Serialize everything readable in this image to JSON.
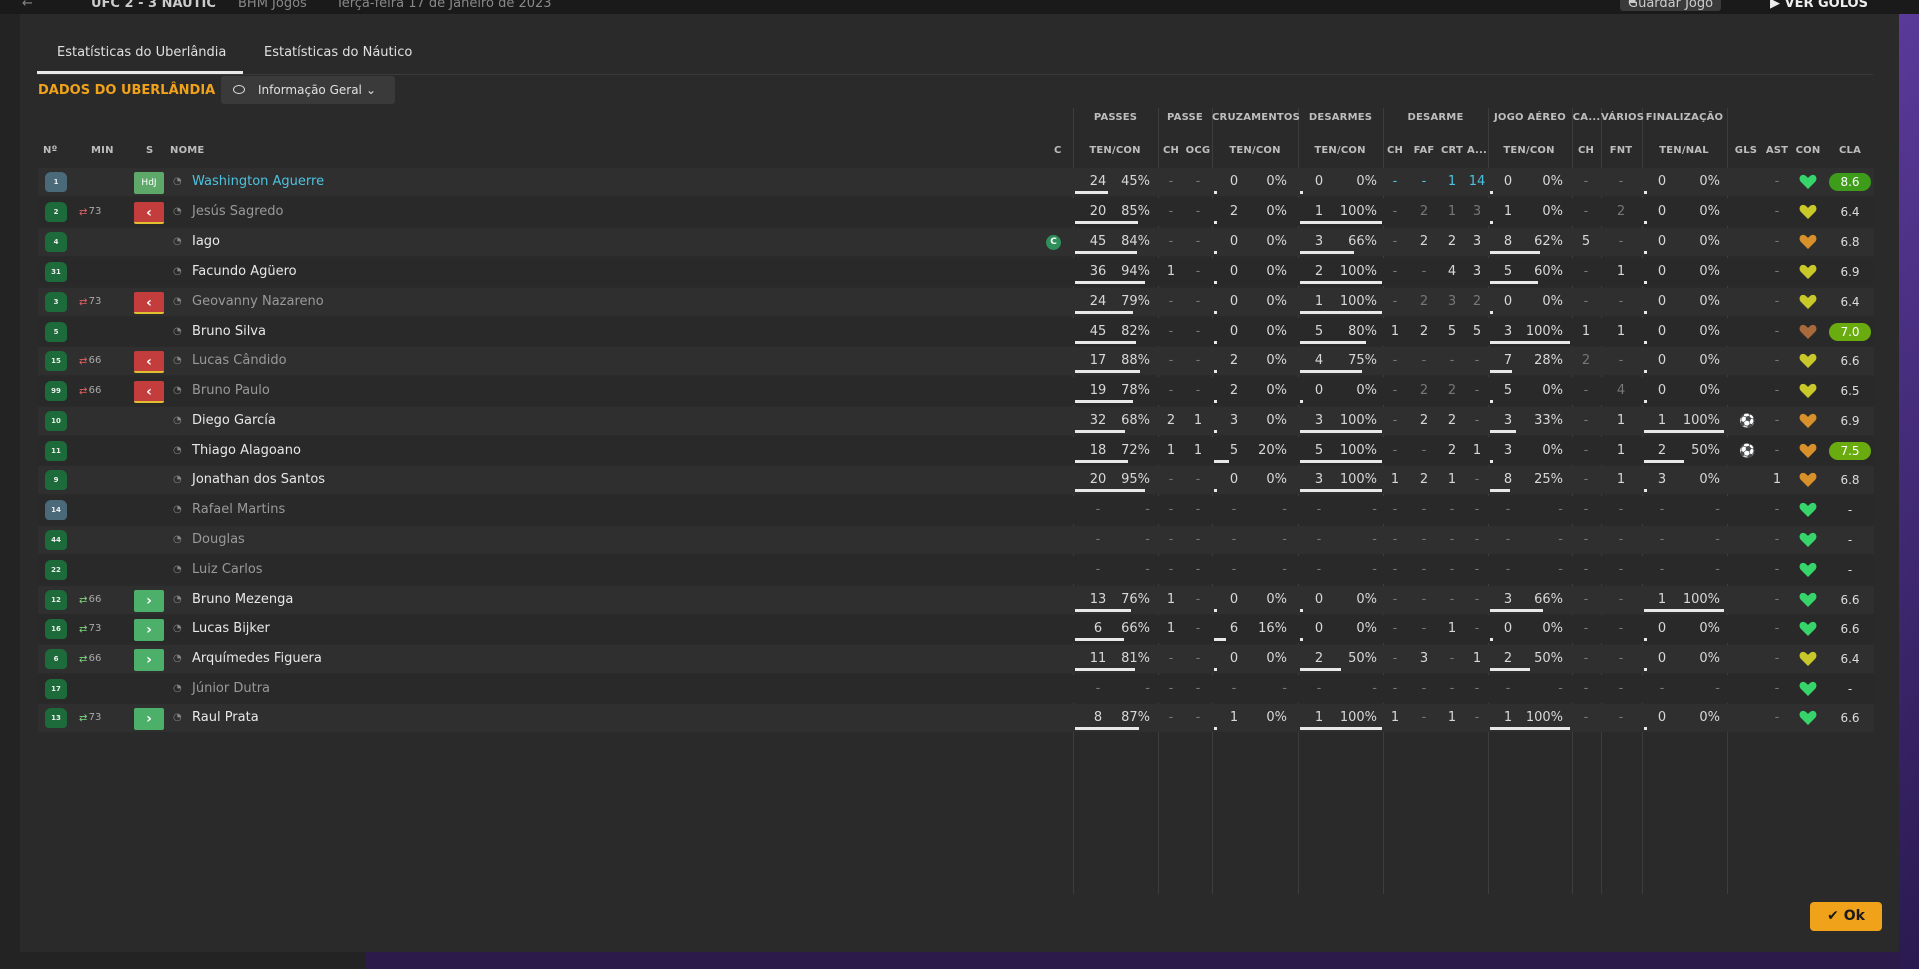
{
  "topbar": {
    "score": "UFC  2 - 3  NÁUTIC",
    "competition": "BHM Jogos",
    "date": "Terça-feira 17 de Janeiro de 2023",
    "save_label": "Guardar Jogo",
    "goals_label": "VER GOLOS"
  },
  "tabs": [
    "Estatísticas do Uberlândia",
    "Estatísticas do Náutico"
  ],
  "section_title": "DADOS DO UBERLÂNDIA",
  "view_dropdown": "Informação Geral",
  "group_headers": {
    "passes": "PASSES",
    "passe": "PASSE",
    "cruzamentos": "CRUZAMENTOS",
    "desarmes": "DESARMES",
    "desarme": "DESARME",
    "jogo_aereo": "JOGO AÉREO",
    "ca": "CA...",
    "varios": "VÁRIOS",
    "finalizacao": "FINALIZAÇÃO"
  },
  "col_headers": {
    "num": "Nº",
    "min": "MIN",
    "s": "S",
    "nome": "NOME",
    "c": "C",
    "passes": "TEN/CON",
    "pch": "CH",
    "pocg": "OCG",
    "cruz": "TEN/CON",
    "des": "TEN/CON",
    "dch": "CH",
    "dfaf": "FAF",
    "dcrt": "CRT",
    "da": "A...",
    "ja": "TEN/CON",
    "cach": "CH",
    "vfnt": "FNT",
    "fin": "TEN/NAL",
    "gls": "GLS",
    "ast": "AST",
    "con": "CON",
    "cla": "CLA"
  },
  "players": [
    {
      "num": "1",
      "gk": true,
      "min": "",
      "sub": "hdj",
      "sub_label": "HdJ",
      "name": "Washington Aguerre",
      "style": "link",
      "cap": false,
      "p": [
        "24",
        "45%"
      ],
      "pch": "-",
      "pocg": "-",
      "cz": [
        "0",
        "0%"
      ],
      "ds": [
        "0",
        "0%"
      ],
      "dch": "-",
      "dfaf": "-",
      "dcrt": "1",
      "da": "14",
      "ja": [
        "0",
        "0%"
      ],
      "cach": "-",
      "fnt": "-",
      "fn": [
        "0",
        "0%"
      ],
      "gls": "",
      "ast": "-",
      "rating": "8.6",
      "rstyle": "green",
      "heart": "green",
      "special": "gk"
    },
    {
      "num": "2",
      "min": "73",
      "sub": "out",
      "name": "Jesús Sagredo",
      "style": "dim",
      "p": [
        "20",
        "85%"
      ],
      "pch": "-",
      "pocg": "-",
      "cz": [
        "2",
        "0%"
      ],
      "ds": [
        "1",
        "100%"
      ],
      "dch": "-",
      "dfaf": "2",
      "dcrt": "1",
      "da": "3",
      "ja": [
        "1",
        "0%"
      ],
      "cach": "-",
      "fnt": "2",
      "fn": [
        "0",
        "0%"
      ],
      "gls": "",
      "ast": "-",
      "rating": "6.4",
      "heart": "yellow"
    },
    {
      "num": "4",
      "min": "",
      "sub": "",
      "name": "Iago",
      "style": "",
      "cap": true,
      "cap_label": "C",
      "p": [
        "45",
        "84%"
      ],
      "pch": "-",
      "pocg": "-",
      "cz": [
        "0",
        "0%"
      ],
      "ds": [
        "3",
        "66%"
      ],
      "dch": "-",
      "dfaf": "2",
      "dcrt": "2",
      "da": "3",
      "ja": [
        "8",
        "62%"
      ],
      "cach": "5",
      "fnt": "-",
      "fn": [
        "0",
        "0%"
      ],
      "gls": "",
      "ast": "-",
      "rating": "6.8",
      "heart": "orange"
    },
    {
      "num": "31",
      "min": "",
      "sub": "",
      "name": "Facundo Agüero",
      "style": "",
      "p": [
        "36",
        "94%"
      ],
      "pch": "1",
      "pocg": "-",
      "cz": [
        "0",
        "0%"
      ],
      "ds": [
        "2",
        "100%"
      ],
      "dch": "-",
      "dfaf": "-",
      "dcrt": "4",
      "da": "3",
      "ja": [
        "5",
        "60%"
      ],
      "cach": "-",
      "fnt": "1",
      "fn": [
        "0",
        "0%"
      ],
      "gls": "",
      "ast": "-",
      "rating": "6.9",
      "heart": "yellow"
    },
    {
      "num": "3",
      "min": "73",
      "sub": "out",
      "name": "Geovanny Nazareno",
      "style": "dim",
      "p": [
        "24",
        "79%"
      ],
      "pch": "-",
      "pocg": "-",
      "cz": [
        "0",
        "0%"
      ],
      "ds": [
        "1",
        "100%"
      ],
      "dch": "-",
      "dfaf": "2",
      "dcrt": "3",
      "da": "2",
      "ja": [
        "0",
        "0%"
      ],
      "cach": "-",
      "fnt": "-",
      "fn": [
        "0",
        "0%"
      ],
      "gls": "",
      "ast": "-",
      "rating": "6.4",
      "heart": "yellow"
    },
    {
      "num": "5",
      "min": "",
      "sub": "",
      "name": "Bruno Silva",
      "style": "",
      "p": [
        "45",
        "82%"
      ],
      "pch": "-",
      "pocg": "-",
      "cz": [
        "0",
        "0%"
      ],
      "ds": [
        "5",
        "80%"
      ],
      "dch": "1",
      "dfaf": "2",
      "dcrt": "5",
      "da": "5",
      "ja": [
        "3",
        "100%"
      ],
      "cach": "1",
      "fnt": "1",
      "fn": [
        "0",
        "0%"
      ],
      "gls": "",
      "ast": "-",
      "rating": "7.0",
      "rstyle": "lime",
      "heart": "brown"
    },
    {
      "num": "15",
      "min": "66",
      "sub": "out",
      "name": "Lucas Cândido",
      "style": "dim",
      "p": [
        "17",
        "88%"
      ],
      "pch": "-",
      "pocg": "-",
      "cz": [
        "2",
        "0%"
      ],
      "ds": [
        "4",
        "75%"
      ],
      "dch": "-",
      "dfaf": "-",
      "dcrt": "-",
      "da": "-",
      "ja": [
        "7",
        "28%"
      ],
      "cach": "2",
      "fnt": "-",
      "fn": [
        "0",
        "0%"
      ],
      "gls": "",
      "ast": "-",
      "rating": "6.6",
      "heart": "yellow"
    },
    {
      "num": "99",
      "min": "66",
      "sub": "out",
      "name": "Bruno Paulo",
      "style": "dim",
      "p": [
        "19",
        "78%"
      ],
      "pch": "-",
      "pocg": "-",
      "cz": [
        "2",
        "0%"
      ],
      "ds": [
        "0",
        "0%"
      ],
      "dch": "-",
      "dfaf": "2",
      "dcrt": "2",
      "da": "-",
      "ja": [
        "5",
        "0%"
      ],
      "cach": "-",
      "fnt": "4",
      "fn": [
        "0",
        "0%"
      ],
      "gls": "",
      "ast": "-",
      "rating": "6.5",
      "heart": "yellow"
    },
    {
      "num": "10",
      "min": "",
      "sub": "",
      "name": "Diego García",
      "style": "",
      "p": [
        "32",
        "68%"
      ],
      "pch": "2",
      "pocg": "1",
      "cz": [
        "3",
        "0%"
      ],
      "ds": [
        "3",
        "100%"
      ],
      "dch": "-",
      "dfaf": "2",
      "dcrt": "2",
      "da": "-",
      "ja": [
        "3",
        "33%"
      ],
      "cach": "-",
      "fnt": "1",
      "fn": [
        "1",
        "100%"
      ],
      "gls": "ball",
      "ast": "-",
      "rating": "6.9",
      "heart": "orange"
    },
    {
      "num": "11",
      "min": "",
      "sub": "",
      "name": "Thiago Alagoano",
      "style": "",
      "p": [
        "18",
        "72%"
      ],
      "pch": "1",
      "pocg": "1",
      "cz": [
        "5",
        "20%"
      ],
      "ds": [
        "5",
        "100%"
      ],
      "dch": "-",
      "dfaf": "-",
      "dcrt": "2",
      "da": "1",
      "ja": [
        "3",
        "0%"
      ],
      "cach": "-",
      "fnt": "1",
      "fn": [
        "2",
        "50%"
      ],
      "gls": "ball",
      "ast": "-",
      "rating": "7.5",
      "rstyle": "lime",
      "heart": "orange"
    },
    {
      "num": "9",
      "min": "",
      "sub": "",
      "name": "Jonathan dos Santos",
      "style": "",
      "p": [
        "20",
        "95%"
      ],
      "pch": "-",
      "pocg": "-",
      "cz": [
        "0",
        "0%"
      ],
      "ds": [
        "3",
        "100%"
      ],
      "dch": "1",
      "dfaf": "2",
      "dcrt": "1",
      "da": "-",
      "ja": [
        "8",
        "25%"
      ],
      "cach": "-",
      "fnt": "1",
      "fn": [
        "3",
        "0%"
      ],
      "gls": "",
      "ast": "1",
      "rating": "6.8",
      "heart": "orange"
    },
    {
      "num": "14",
      "gk": true,
      "min": "",
      "sub": "",
      "name": "Rafael Martins",
      "style": "dim",
      "p": [
        "-",
        "-"
      ],
      "pch": "-",
      "pocg": "-",
      "cz": [
        "-",
        "-"
      ],
      "ds": [
        "-",
        "-"
      ],
      "dch": "-",
      "dfaf": "-",
      "dcrt": "-",
      "da": "-",
      "ja": [
        "-",
        "-"
      ],
      "cach": "-",
      "fnt": "-",
      "fn": [
        "-",
        "-"
      ],
      "gls": "",
      "ast": "-",
      "rating": "-",
      "heart": "green"
    },
    {
      "num": "44",
      "min": "",
      "sub": "",
      "name": "Douglas",
      "style": "dim",
      "p": [
        "-",
        "-"
      ],
      "pch": "-",
      "pocg": "-",
      "cz": [
        "-",
        "-"
      ],
      "ds": [
        "-",
        "-"
      ],
      "dch": "-",
      "dfaf": "-",
      "dcrt": "-",
      "da": "-",
      "ja": [
        "-",
        "-"
      ],
      "cach": "-",
      "fnt": "-",
      "fn": [
        "-",
        "-"
      ],
      "gls": "",
      "ast": "-",
      "rating": "-",
      "heart": "green"
    },
    {
      "num": "22",
      "min": "",
      "sub": "",
      "name": "Luiz Carlos",
      "style": "dim",
      "p": [
        "-",
        "-"
      ],
      "pch": "-",
      "pocg": "-",
      "cz": [
        "-",
        "-"
      ],
      "ds": [
        "-",
        "-"
      ],
      "dch": "-",
      "dfaf": "-",
      "dcrt": "-",
      "da": "-",
      "ja": [
        "-",
        "-"
      ],
      "cach": "-",
      "fnt": "-",
      "fn": [
        "-",
        "-"
      ],
      "gls": "",
      "ast": "-",
      "rating": "-",
      "heart": "green"
    },
    {
      "num": "12",
      "min": "66",
      "sub": "in",
      "name": "Bruno Mezenga",
      "style": "",
      "p": [
        "13",
        "76%"
      ],
      "pch": "1",
      "pocg": "-",
      "cz": [
        "0",
        "0%"
      ],
      "ds": [
        "0",
        "0%"
      ],
      "dch": "-",
      "dfaf": "-",
      "dcrt": "-",
      "da": "-",
      "ja": [
        "3",
        "66%"
      ],
      "cach": "-",
      "fnt": "-",
      "fn": [
        "1",
        "100%"
      ],
      "gls": "",
      "ast": "-",
      "rating": "6.6",
      "heart": "green"
    },
    {
      "num": "16",
      "min": "73",
      "sub": "in",
      "name": "Lucas Bijker",
      "style": "",
      "p": [
        "6",
        "66%"
      ],
      "pch": "1",
      "pocg": "-",
      "cz": [
        "6",
        "16%"
      ],
      "ds": [
        "0",
        "0%"
      ],
      "dch": "-",
      "dfaf": "-",
      "dcrt": "1",
      "da": "-",
      "ja": [
        "0",
        "0%"
      ],
      "cach": "-",
      "fnt": "-",
      "fn": [
        "0",
        "0%"
      ],
      "gls": "",
      "ast": "-",
      "rating": "6.6",
      "heart": "green"
    },
    {
      "num": "6",
      "min": "66",
      "sub": "in",
      "name": "Arquímedes Figuera",
      "style": "",
      "p": [
        "11",
        "81%"
      ],
      "pch": "-",
      "pocg": "-",
      "cz": [
        "0",
        "0%"
      ],
      "ds": [
        "2",
        "50%"
      ],
      "dch": "-",
      "dfaf": "3",
      "dcrt": "-",
      "da": "1",
      "ja": [
        "2",
        "50%"
      ],
      "cach": "-",
      "fnt": "-",
      "fn": [
        "0",
        "0%"
      ],
      "gls": "",
      "ast": "-",
      "rating": "6.4",
      "heart": "yellow"
    },
    {
      "num": "17",
      "min": "",
      "sub": "",
      "name": "Júnior Dutra",
      "style": "dim",
      "p": [
        "-",
        "-"
      ],
      "pch": "-",
      "pocg": "-",
      "cz": [
        "-",
        "-"
      ],
      "ds": [
        "-",
        "-"
      ],
      "dch": "-",
      "dfaf": "-",
      "dcrt": "-",
      "da": "-",
      "ja": [
        "-",
        "-"
      ],
      "cach": "-",
      "fnt": "-",
      "fn": [
        "-",
        "-"
      ],
      "gls": "",
      "ast": "-",
      "rating": "-",
      "heart": "green"
    },
    {
      "num": "13",
      "min": "73",
      "sub": "in",
      "name": "Raul Prata",
      "style": "",
      "p": [
        "8",
        "87%"
      ],
      "pch": "-",
      "pocg": "-",
      "cz": [
        "1",
        "0%"
      ],
      "ds": [
        "1",
        "100%"
      ],
      "dch": "1",
      "dfaf": "-",
      "dcrt": "1",
      "da": "-",
      "ja": [
        "1",
        "100%"
      ],
      "cach": "-",
      "fnt": "-",
      "fn": [
        "0",
        "0%"
      ],
      "gls": "",
      "ast": "-",
      "rating": "6.6",
      "heart": "green"
    }
  ],
  "ok_label": "Ok",
  "colors": {
    "accent": "#f0a21a",
    "link": "#4cc3e0",
    "sub_out": "#c43d3d",
    "sub_in": "#4caf6a",
    "heart_green": "#36d46a",
    "heart_yellow": "#c8c82a",
    "heart_orange": "#d8902a",
    "heart_brown": "#a86a3a"
  }
}
